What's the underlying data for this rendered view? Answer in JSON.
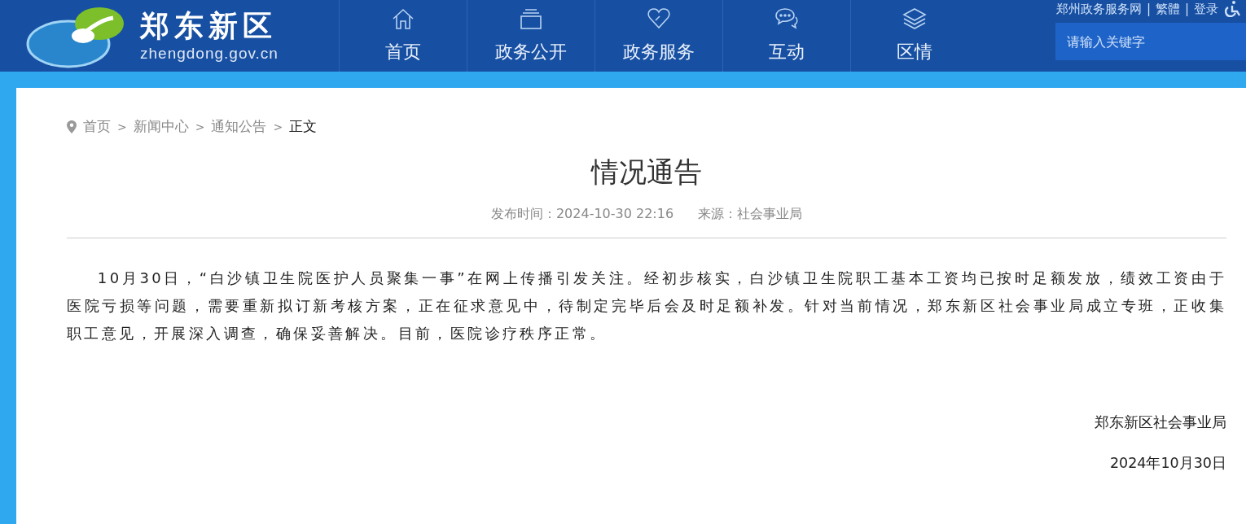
{
  "header": {
    "logo_title": "郑东新区",
    "logo_domain": "zhengdong.gov.cn",
    "nav": [
      {
        "label": "首页"
      },
      {
        "label": "政务公开"
      },
      {
        "label": "政务服务"
      },
      {
        "label": "互动"
      },
      {
        "label": "区情"
      }
    ],
    "top_links": [
      "郑州政务服务网",
      "繁體",
      "登录"
    ],
    "top_separator": "|",
    "search": {
      "placeholder": "请输入关键字"
    }
  },
  "breadcrumb": {
    "separator": ">",
    "items": [
      {
        "label": "首页",
        "current": false
      },
      {
        "label": "新闻中心",
        "current": false
      },
      {
        "label": "通知公告",
        "current": false
      },
      {
        "label": "正文",
        "current": true
      }
    ]
  },
  "article": {
    "title": "情况通告",
    "published": "发布时间：2024-10-30 22:16",
    "source": "来源：社会事业局",
    "body": "10月30日，“白沙镇卫生院医护人员聚集一事”在网上传播引发关注。经初步核实，白沙镇卫生院职工基本工资均已按时足额发放，绩效工资由于医院亏损等问题，需要重新拟订新考核方案，正在征求意见中，待制定完毕后会及时足额补发。针对当前情况，郑东新区社会事业局成立专班，正收集职工意见，开展深入调查，确保妥善解决。目前，医院诊疗秩序正常。",
    "signature": "郑东新区社会事业局",
    "date": "2024年10月30日"
  }
}
